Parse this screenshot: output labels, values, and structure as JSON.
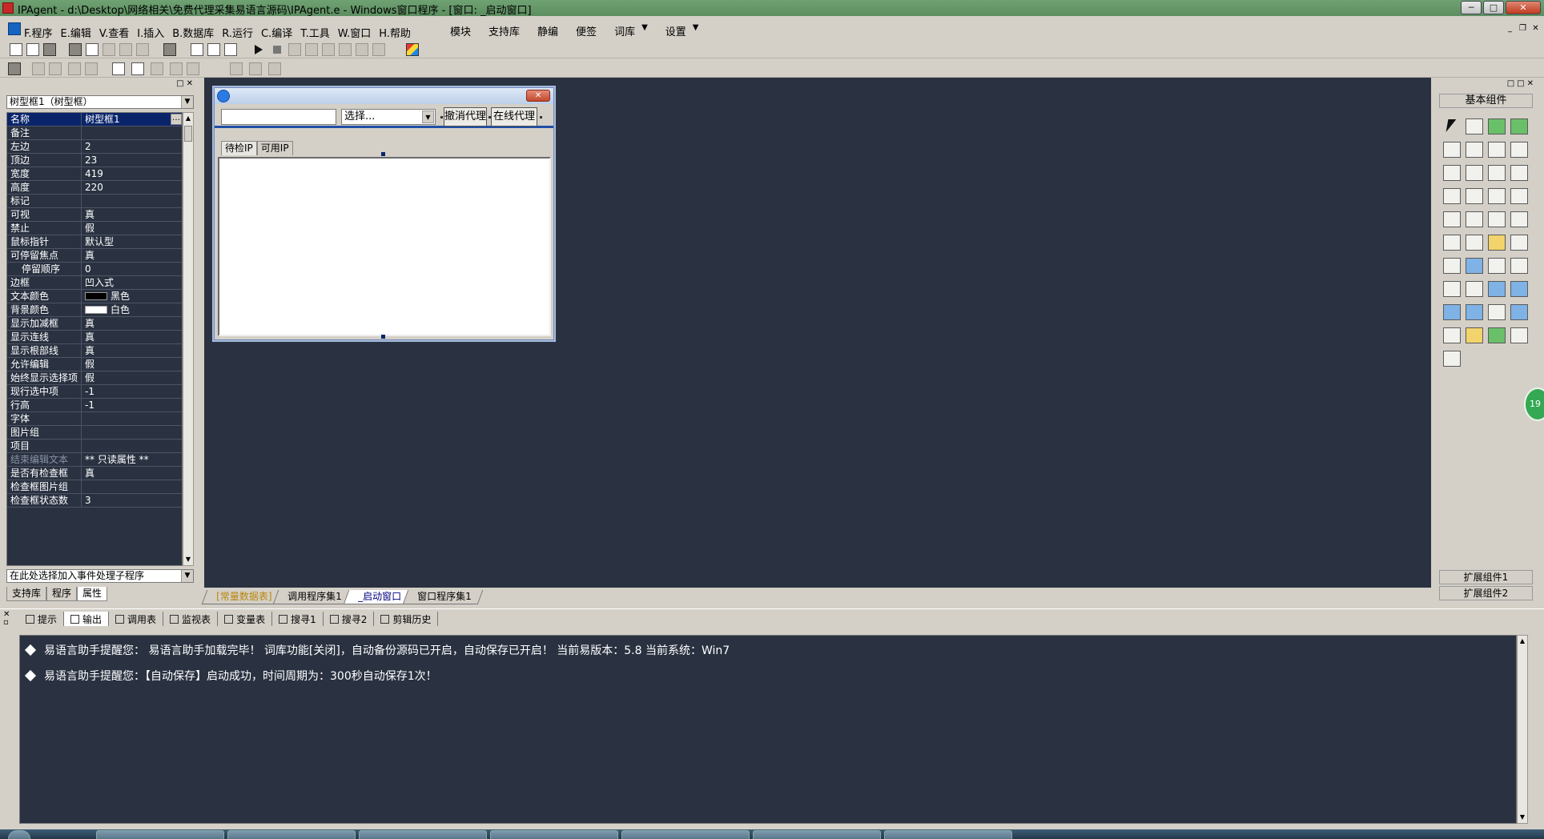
{
  "window": {
    "title": "IPAgent - d:\\Desktop\\网络相关\\免费代理采集易语言源码\\IPAgent.e - Windows窗口程序 - [窗口: _启动窗口]",
    "controls": [
      "─",
      "□",
      "✕"
    ]
  },
  "menu": {
    "items": [
      "F.程序",
      "E.编辑",
      "V.查看",
      "I.插入",
      "B.数据库",
      "R.运行",
      "C.编译",
      "T.工具",
      "W.窗口",
      "H.帮助"
    ],
    "extra": [
      "模块",
      "支持库",
      "静编",
      "便签",
      "词库",
      "设置"
    ],
    "mdi_controls": [
      "_",
      "❐",
      "✕"
    ]
  },
  "left_panel": {
    "controls": [
      "□",
      "✕"
    ],
    "object_combo": "树型框1（树型框）",
    "ellipsis": "…",
    "properties": [
      {
        "name": "名称",
        "value": "树型框1"
      },
      {
        "name": "备注",
        "value": ""
      },
      {
        "name": "左边",
        "value": "2"
      },
      {
        "name": "顶边",
        "value": "23"
      },
      {
        "name": "宽度",
        "value": "419"
      },
      {
        "name": "高度",
        "value": "220"
      },
      {
        "name": "标记",
        "value": ""
      },
      {
        "name": "可视",
        "value": "真"
      },
      {
        "name": "禁止",
        "value": "假"
      },
      {
        "name": "鼠标指针",
        "value": "默认型"
      },
      {
        "name": "可停留焦点",
        "value": "真"
      },
      {
        "name": "停留顺序",
        "value": "0"
      },
      {
        "name": "边框",
        "value": "凹入式"
      },
      {
        "name": "文本颜色",
        "value": "黑色"
      },
      {
        "name": "背景颜色",
        "value": "白色"
      },
      {
        "name": "显示加减框",
        "value": "真"
      },
      {
        "name": "显示连线",
        "value": "真"
      },
      {
        "name": "显示根部线",
        "value": "真"
      },
      {
        "name": "允许编辑",
        "value": "假"
      },
      {
        "name": "始终显示选择项",
        "value": "假"
      },
      {
        "name": "现行选中项",
        "value": "-1"
      },
      {
        "name": "行高",
        "value": "-1"
      },
      {
        "name": "字体",
        "value": ""
      },
      {
        "name": "图片组",
        "value": ""
      },
      {
        "name": "项目",
        "value": ""
      },
      {
        "name": "结束编辑文本",
        "value": "** 只读属性 **"
      },
      {
        "name": "是否有检查框",
        "value": "真"
      },
      {
        "name": "检查框图片组",
        "value": ""
      },
      {
        "name": "检查框状态数",
        "value": "3"
      }
    ],
    "text_color_swatch": "#000000",
    "bg_color_swatch": "#ffffff",
    "event_combo": "在此处选择加入事件处理子程序",
    "tabs": [
      "支持库",
      "程序",
      "属性"
    ]
  },
  "form": {
    "close_label": "✕",
    "select_placeholder": "选择...",
    "cancel_proxy": "撤消代理",
    "online_proxy": "在线代理",
    "tabs": [
      "待检IP",
      "可用IP"
    ]
  },
  "doc_tabs": [
    "[常量数据表]",
    "调用程序集1",
    "_启动窗口",
    "窗口程序集1"
  ],
  "right_panel": {
    "controls": [
      "□",
      "□",
      "✕"
    ],
    "header": "基本组件",
    "ext1": "扩展组件1",
    "ext2": "扩展组件2",
    "badge": "19"
  },
  "bottom_panel": {
    "controls": [
      "✕",
      "▫"
    ],
    "tabs": [
      {
        "label": "提示",
        "icon": "hint-icon"
      },
      {
        "label": "输出",
        "icon": "output-icon"
      },
      {
        "label": "调用表",
        "icon": "call-table-icon"
      },
      {
        "label": "监视表",
        "icon": "watch-icon"
      },
      {
        "label": "变量表",
        "icon": "variables-icon"
      },
      {
        "label": "搜寻1",
        "icon": "search1-icon"
      },
      {
        "label": "搜寻2",
        "icon": "search2-icon"
      },
      {
        "label": "剪辑历史",
        "icon": "clip-history-icon"
      }
    ],
    "lines": [
      "易语言助手提醒您： 易语言助手加载完毕！ 词库功能[关闭]，自动备份源码已开启，自动保存已开启！ 当前易版本：5.8 当前系统：Win7",
      "易语言助手提醒您：【自动保存】启动成功，时间周期为：300秒自动保存1次！"
    ]
  },
  "colors": {
    "dark_bg": "#2a3241",
    "selection": "#0a246a",
    "title_bar": "#6fa273"
  }
}
